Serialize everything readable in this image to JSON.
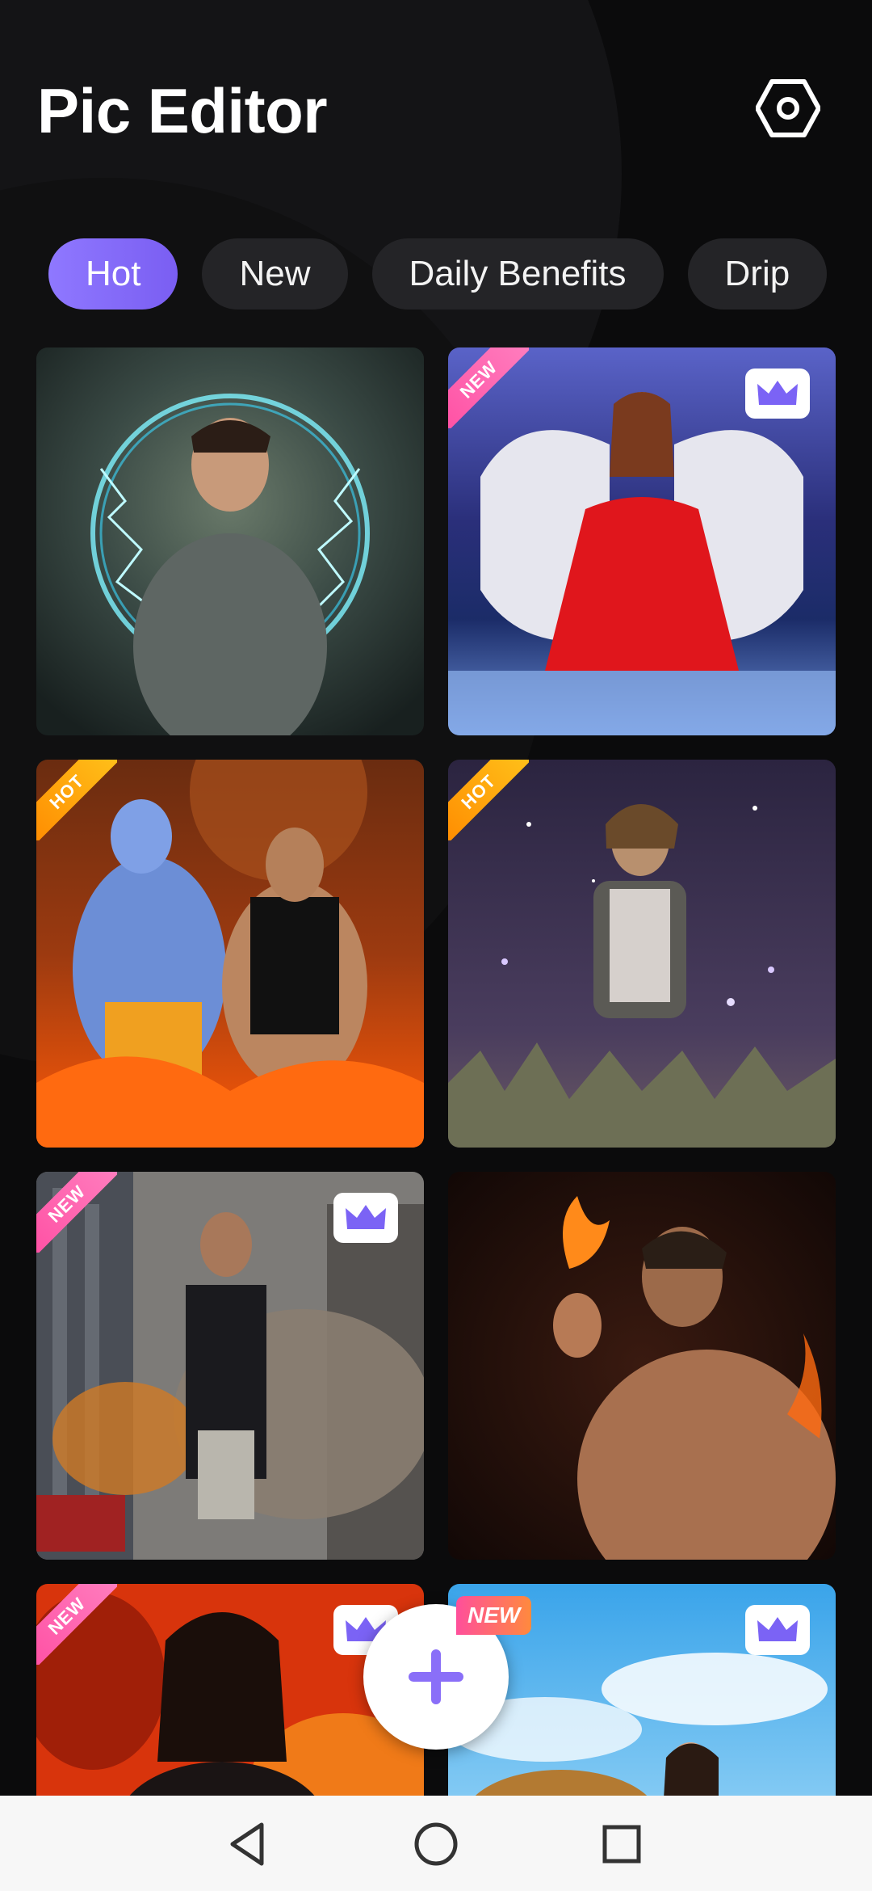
{
  "app": {
    "title": "Pic Editor"
  },
  "tabs": [
    {
      "label": "Hot",
      "active": true
    },
    {
      "label": "New",
      "active": false
    },
    {
      "label": "Daily Benefits",
      "active": false
    },
    {
      "label": "Drip",
      "active": false
    }
  ],
  "cards": [
    {
      "ribbon": "",
      "premium": false
    },
    {
      "ribbon": "NEW",
      "premium": true
    },
    {
      "ribbon": "HOT",
      "premium": false
    },
    {
      "ribbon": "HOT",
      "premium": false
    },
    {
      "ribbon": "NEW",
      "premium": true
    },
    {
      "ribbon": "",
      "premium": false
    },
    {
      "ribbon": "NEW",
      "premium": true
    },
    {
      "ribbon": "",
      "premium": true
    }
  ],
  "fab": {
    "badge": "NEW",
    "icon": "plus-icon"
  },
  "colors": {
    "accent": "#8a6ff8",
    "crown": "#7b63f5",
    "new_ribbon": "#ff5aa8",
    "hot_ribbon": "#ffa31a"
  },
  "nav": {
    "back": "back-triangle-icon",
    "home": "home-circle-icon",
    "recents": "recents-square-icon"
  }
}
